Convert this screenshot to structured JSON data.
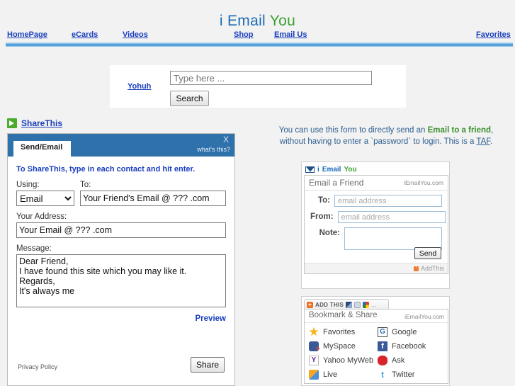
{
  "header": {
    "brand": {
      "part1": "i",
      "part2": "Email",
      "part3": "You"
    },
    "nav_left": [
      {
        "label": "HomePage",
        "name": "nav-homepage"
      },
      {
        "label": "eCards",
        "name": "nav-ecards"
      },
      {
        "label": "Videos",
        "name": "nav-videos"
      }
    ],
    "nav_right": [
      {
        "label": "Shop",
        "name": "nav-shop"
      },
      {
        "label": "Email Us",
        "name": "nav-email-us"
      },
      {
        "label": "Favorites",
        "name": "nav-favorites"
      }
    ]
  },
  "search": {
    "side_link": "Yohuh",
    "placeholder": "Type here ...",
    "value": "",
    "button_label": "Search"
  },
  "sharethis": {
    "link_label": "ShareThis",
    "tab_label": "Send/Email",
    "close_label": "X",
    "whats_this": "what's this?",
    "instructions": "To ShareThis, type in each contact and hit enter.",
    "using_label": "Using:",
    "using_value": "Email",
    "using_options": [
      "Email"
    ],
    "to_label": "To:",
    "to_value": "Your Friend's Email @ ??? .com",
    "address_label": "Your Address:",
    "address_value": "Your Email @ ??? .com",
    "message_label": "Message:",
    "message_value": "Dear Friend,\nI have found this site which you may like it.\nRegards,\nIt's always me",
    "preview_label": "Preview",
    "privacy_label": "Privacy Policy",
    "share_button": "Share"
  },
  "right_intro": {
    "line1_a": "You can use this form to directly send an ",
    "line1_b": "Email to a friend",
    "line1_c": ",",
    "line2_a": "without having to enter a `password` to login. This is a ",
    "line2_b": "TAF",
    "line2_c": "."
  },
  "email_a_friend": {
    "brand": {
      "part1": "i",
      "part2": "Email",
      "part3": "You"
    },
    "title": "Email a Friend",
    "site": "iEmailYou.com",
    "to_label": "To:",
    "to_placeholder": "email address",
    "to_value": "",
    "from_label": "From:",
    "from_placeholder": "email address",
    "from_value": "",
    "note_label": "Note:",
    "note_value": "",
    "send_label": "Send",
    "addthis_label": "AddThis"
  },
  "bookmark_share": {
    "tab_label": "ADD THIS",
    "tab_ellipsis": "...",
    "title": "Bookmark & Share",
    "site": "iEmailYou.com",
    "items": [
      {
        "label": "Favorites",
        "icon": "favorites-icon"
      },
      {
        "label": "Google",
        "icon": "google-icon"
      },
      {
        "label": "MySpace",
        "icon": "myspace-icon"
      },
      {
        "label": "Facebook",
        "icon": "facebook-icon"
      },
      {
        "label": "Yahoo MyWeb",
        "icon": "yahoo-myweb-icon"
      },
      {
        "label": "Ask",
        "icon": "ask-icon"
      },
      {
        "label": "Live",
        "icon": "live-icon"
      },
      {
        "label": "Twitter",
        "icon": "twitter-icon"
      }
    ]
  },
  "colors": {
    "brand_blue": "#1b6bb5",
    "brand_green": "#3aa033",
    "link_blue": "#1a3fbe",
    "sharethis_header": "#2f72ab",
    "page_bg": "#f2f2f2"
  }
}
